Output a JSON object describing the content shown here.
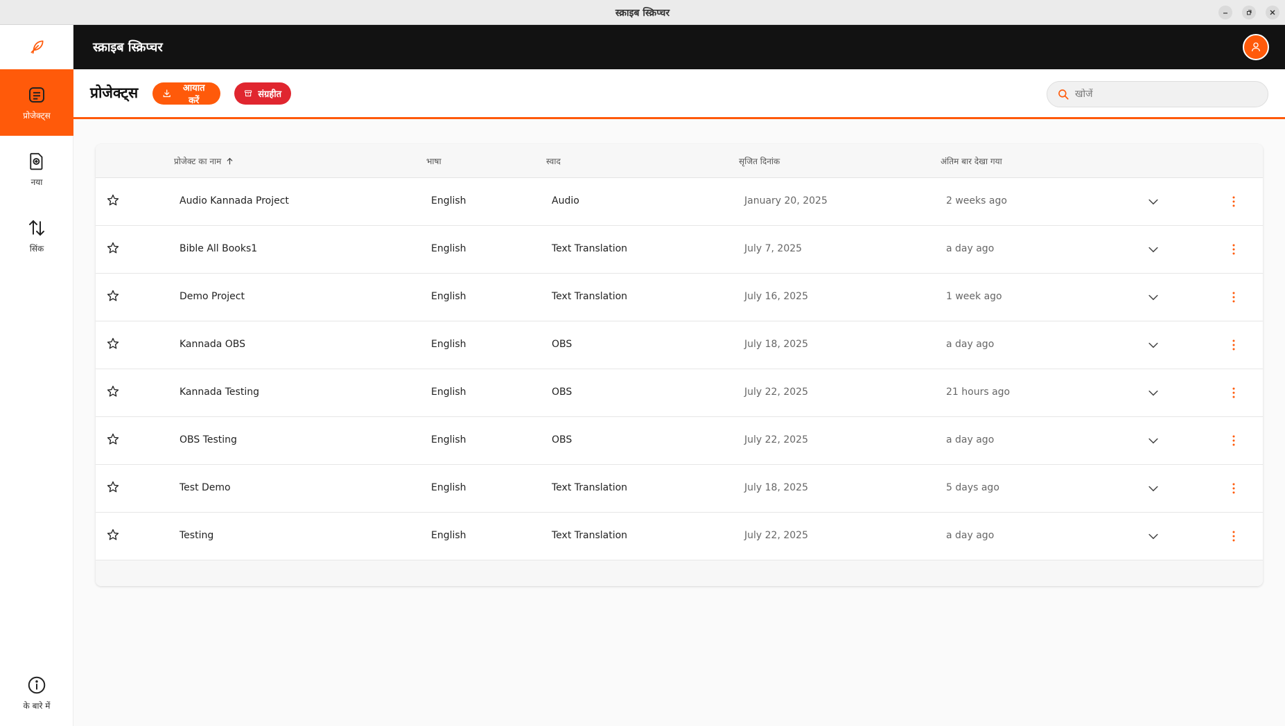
{
  "window": {
    "title": "स्क्राइब स्क्रिप्चर"
  },
  "header": {
    "title": "स्क्राइब स्क्रिप्चर"
  },
  "sidebar": {
    "items": [
      {
        "label": "प्रोजेक्ट्स",
        "icon": "projects-icon",
        "active": true
      },
      {
        "label": "नया",
        "icon": "new-project-icon"
      },
      {
        "label": "सिंक",
        "icon": "sync-icon"
      },
      {
        "label": "के बारे में",
        "icon": "info-icon"
      }
    ]
  },
  "toolbar": {
    "title": "प्रोजेक्ट्स",
    "import_label": "आयात करें",
    "archive_label": "संग्रहीत",
    "search_placeholder": "खोजें"
  },
  "table": {
    "columns": {
      "name": "प्रोजेक्ट का नाम",
      "language": "भाषा",
      "flavor": "स्वाद",
      "created": "सृजित दिनांक",
      "last_viewed": "अंतिम बार देखा गया"
    },
    "rows": [
      {
        "name": "Audio Kannada Project",
        "language": "English",
        "flavor": "Audio",
        "created": "January 20, 2025",
        "last_viewed": "2 weeks ago"
      },
      {
        "name": "Bible All Books1",
        "language": "English",
        "flavor": "Text Translation",
        "created": "July 7, 2025",
        "last_viewed": "a day ago"
      },
      {
        "name": "Demo Project",
        "language": "English",
        "flavor": "Text Translation",
        "created": "July 16, 2025",
        "last_viewed": "1 week ago"
      },
      {
        "name": "Kannada OBS",
        "language": "English",
        "flavor": "OBS",
        "created": "July 18, 2025",
        "last_viewed": "a day ago"
      },
      {
        "name": "Kannada Testing",
        "language": "English",
        "flavor": "OBS",
        "created": "July 22, 2025",
        "last_viewed": "21 hours ago"
      },
      {
        "name": "OBS Testing",
        "language": "English",
        "flavor": "OBS",
        "created": "July 22, 2025",
        "last_viewed": "a day ago"
      },
      {
        "name": "Test Demo",
        "language": "English",
        "flavor": "Text Translation",
        "created": "July 18, 2025",
        "last_viewed": "5 days ago"
      },
      {
        "name": "Testing",
        "language": "English",
        "flavor": "Text Translation",
        "created": "July 22, 2025",
        "last_viewed": "a day ago"
      }
    ]
  },
  "colors": {
    "accent": "#ff5a0a",
    "archive": "#e0262f",
    "header_bg": "#121212"
  }
}
